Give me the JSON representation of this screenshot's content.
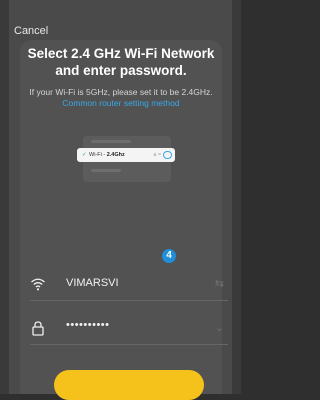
{
  "header": {
    "cancel_label": "Cancel"
  },
  "main": {
    "title": "Select 2.4 GHz Wi-Fi Network and enter password.",
    "subtitle": "If your Wi-Fi is 5GHz, please set it to be 2.4GHz.",
    "subtitle_link": "Common router setting method",
    "illustration": {
      "ssid_prefix": "Wi-Fi - ",
      "ssid_band": "2.4Ghz",
      "right_glyphs": "a ≈"
    },
    "step_badge": "4",
    "wifi_field": {
      "value": "VIMARSVI",
      "icon": "wifi-icon",
      "trail_icon": "switch-arrows-icon"
    },
    "password_field": {
      "value": "••••••••••",
      "icon": "lock-icon",
      "trail_icon": "chevron-down-icon"
    }
  },
  "colors": {
    "accent": "#1e8fd8",
    "link": "#39a8e6",
    "cta": "#f5c21b"
  }
}
